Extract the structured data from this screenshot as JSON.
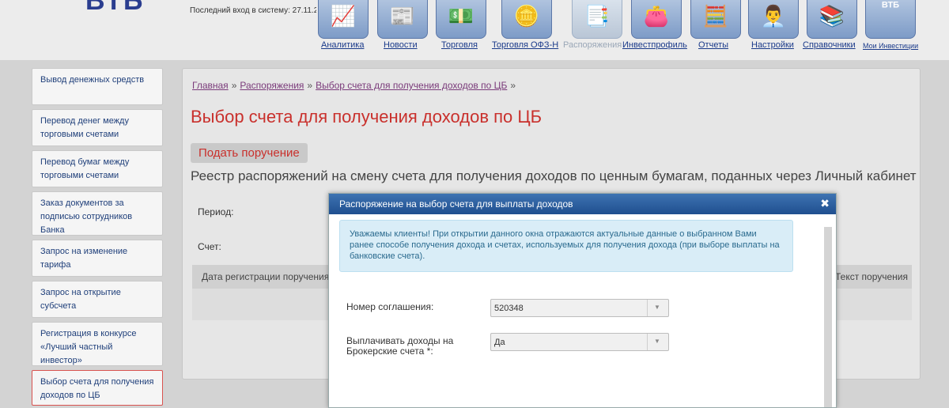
{
  "header": {
    "logo": "ВТБ",
    "last_login": "Последний вход в систему: 27.11.2",
    "nav": [
      {
        "label": "Аналитика",
        "icon": "chart-icon",
        "glyph": "📈",
        "dim": false,
        "small": false
      },
      {
        "label": "Новости",
        "icon": "newspaper-icon",
        "glyph": "📰",
        "dim": false,
        "small": false
      },
      {
        "label": "Торговля",
        "icon": "money-icon",
        "glyph": "💵",
        "dim": false,
        "small": false
      },
      {
        "label": "Торговля ОФЗ-Н",
        "icon": "coins-globe-icon",
        "glyph": "🪙",
        "dim": false,
        "small": false
      },
      {
        "label": "Распоряжения",
        "icon": "documents-icon",
        "glyph": "📑",
        "dim": true,
        "small": false
      },
      {
        "label": "Инвестпрофиль",
        "icon": "wallet-icon",
        "glyph": "👛",
        "dim": false,
        "small": false
      },
      {
        "label": "Отчеты",
        "icon": "calculator-icon",
        "glyph": "🧮",
        "dim": false,
        "small": false
      },
      {
        "label": "Настройки",
        "icon": "support-agent-icon",
        "glyph": "👨‍💼",
        "dim": false,
        "small": false
      },
      {
        "label": "Справочники",
        "icon": "books-icon",
        "glyph": "📚",
        "dim": false,
        "small": false
      },
      {
        "label": "Мои Инвестиции",
        "icon": "vtb-investments-icon",
        "glyph": "ВТБ",
        "dim": false,
        "small": true
      }
    ]
  },
  "sidebar": {
    "items": [
      {
        "label": "Вывод денежных средств",
        "active": false
      },
      {
        "label": "Перевод денег между торговыми счетами",
        "active": false
      },
      {
        "label": "Перевод бумаг между торговыми счетами",
        "active": false
      },
      {
        "label": "Заказ документов за подписью сотрудников Банка",
        "active": false
      },
      {
        "label": "Запрос на изменение тарифа",
        "active": false
      },
      {
        "label": "Запрос на открытие субсчета",
        "active": false
      },
      {
        "label": "Регистрация в конкурсе «Лучший частный инвестор»",
        "active": false
      },
      {
        "label": "Выбор счета для получения доходов по ЦБ",
        "active": true
      }
    ]
  },
  "main": {
    "breadcrumb": [
      "Главная",
      "Распоряжения",
      "Выбор счета для получения доходов по ЦБ"
    ],
    "breadcrumb_sep": "»",
    "title": "Выбор счета для получения доходов по ЦБ",
    "submit_label": "Подать поручение",
    "registry_title": "Реестр распоряжений на смену счета для получения доходов по ценным бумагам, поданных через Личный кабинет",
    "period_label": "Период:",
    "account_label": "Счет:",
    "table_headers": {
      "date": "Дата регистрации поручения",
      "text": "Текст поручения"
    }
  },
  "modal": {
    "title": "Распоряжение на выбор счета для выплаты доходов",
    "close_glyph": "✖",
    "notice": "Уважаемы клиенты! При открытии данного окна отражаются актуальные данные о выбранном Вами ранее способе получения дохода и счетах, используемых для получения дохода (при выборе выплаты на банковские счета).",
    "fields": [
      {
        "label": "Номер соглашения:",
        "value": "520348"
      },
      {
        "label": "Выплачивать доходы на Брокерские счета *:",
        "value": "Да"
      }
    ],
    "arrow_glyph": "▼"
  },
  "colors": {
    "accent_red": "#c9302c",
    "modal_header": "#1f4f8f",
    "notice_bg": "#d9edf7"
  }
}
